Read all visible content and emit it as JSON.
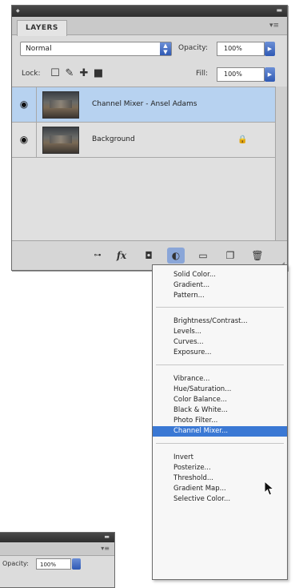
{
  "panel": {
    "tab_label": "LAYERS",
    "blend_mode": "Normal",
    "opacity_label": "Opacity:",
    "opacity_value": "100%",
    "lock_label": "Lock:",
    "fill_label": "Fill:",
    "fill_value": "100%",
    "layers": [
      {
        "name": "Channel Mixer - Ansel Adams",
        "selected": true
      },
      {
        "name": "Background",
        "selected": false,
        "locked": true
      }
    ],
    "bottom_icons": [
      "link-icon",
      "fx-icon",
      "mask-icon",
      "adjustment-icon",
      "group-icon",
      "new-layer-icon",
      "trash-icon"
    ]
  },
  "menu": {
    "groups": [
      [
        "Solid Color...",
        "Gradient...",
        "Pattern..."
      ],
      [
        "Brightness/Contrast...",
        "Levels...",
        "Curves...",
        "Exposure..."
      ],
      [
        "Vibrance...",
        "Hue/Saturation...",
        "Color Balance...",
        "Black & White...",
        "Photo Filter...",
        "Channel Mixer..."
      ],
      [
        "Invert",
        "Posterize...",
        "Threshold...",
        "Gradient Map...",
        "Selective Color..."
      ]
    ],
    "highlighted": "Channel Mixer..."
  },
  "panel2": {
    "opacity_label": "Opacity:",
    "opacity_value": "100%"
  },
  "colors": {
    "selection": "#3a78d4",
    "selected_layer": "#b7d2f0",
    "panel_bg": "#dcdcdc"
  }
}
